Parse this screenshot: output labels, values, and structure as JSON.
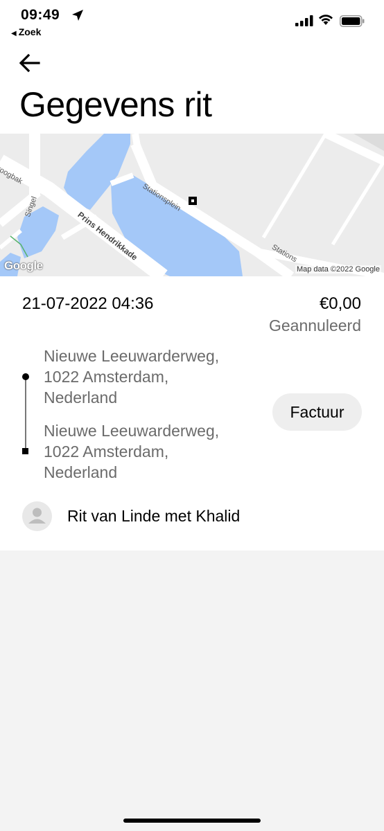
{
  "status_bar": {
    "time": "09:49",
    "back_app": "Zoek"
  },
  "header": {
    "title": "Gegevens rit"
  },
  "map": {
    "labels": {
      "stationsplein": "Stationsplein",
      "singel": "Singel",
      "prins_hendrikkade": "Prins Hendrikkade",
      "droogbak": "roogbak",
      "stations2": "Stations"
    },
    "google": "Google",
    "attribution": "Map data ©2022 Google",
    "colors": {
      "water": "#a4c8f8",
      "land": "#ececec",
      "road": "#ffffff"
    }
  },
  "trip": {
    "datetime": "21-07-2022 04:36",
    "price": "€0,00",
    "status": "Geannuleerd",
    "pickup": [
      "Nieuwe Leeuwarderweg,",
      "1022 Amsterdam,",
      "Nederland"
    ],
    "dropoff": [
      "Nieuwe Leeuwarderweg,",
      "1022 Amsterdam,",
      "Nederland"
    ],
    "invoice_label": "Factuur",
    "rider_text": "Rit van Linde met Khalid"
  }
}
